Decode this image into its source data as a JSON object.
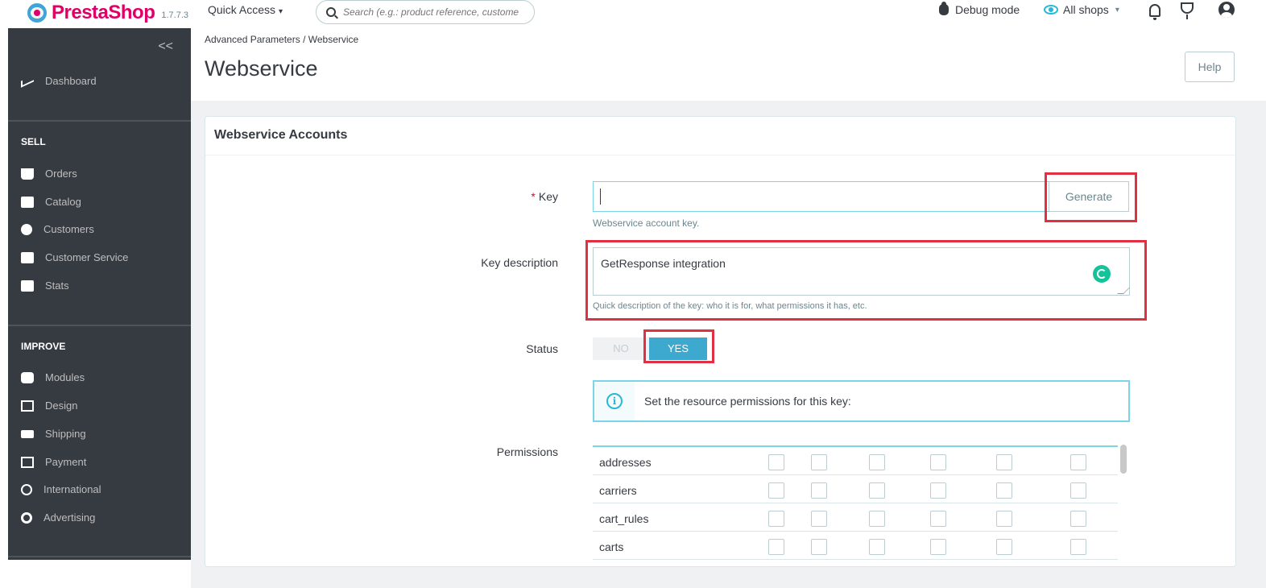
{
  "topbar": {
    "logo_text": "PrestaShop",
    "version": "1.7.7.3",
    "quick_access": "Quick Access",
    "search_placeholder": "Search (e.g.: product reference, custome",
    "debug_mode": "Debug mode",
    "all_shops": "All shops"
  },
  "sidebar": {
    "collapse": "<<",
    "dashboard": "Dashboard",
    "sell_title": "SELL",
    "sell_items": [
      "Orders",
      "Catalog",
      "Customers",
      "Customer Service",
      "Stats"
    ],
    "improve_title": "IMPROVE",
    "improve_items": [
      "Modules",
      "Design",
      "Shipping",
      "Payment",
      "International",
      "Advertising"
    ]
  },
  "header": {
    "breadcrumb": "Advanced Parameters  /  Webservice",
    "title": "Webservice",
    "help_label": "Help"
  },
  "panel": {
    "title": "Webservice Accounts",
    "key_required_mark": "*",
    "key_label": "Key",
    "key_value": "",
    "generate_label": "Generate",
    "key_help": "Webservice account key.",
    "desc_label": "Key description",
    "desc_value": "GetResponse integration",
    "desc_help": "Quick description of the key: who it is for, what permissions it has, etc.",
    "status_label": "Status",
    "status_no": "NO",
    "status_yes": "YES",
    "info_text": "Set the resource permissions for this key:",
    "permissions_label": "Permissions",
    "resources": [
      "addresses",
      "carriers",
      "cart_rules",
      "carts"
    ]
  },
  "colors": {
    "brand": "#df0067",
    "accent": "#25b9d7",
    "sidebar_bg": "#363a41",
    "toggle_yes": "#3ea9cf",
    "annotation": "#e03041"
  }
}
